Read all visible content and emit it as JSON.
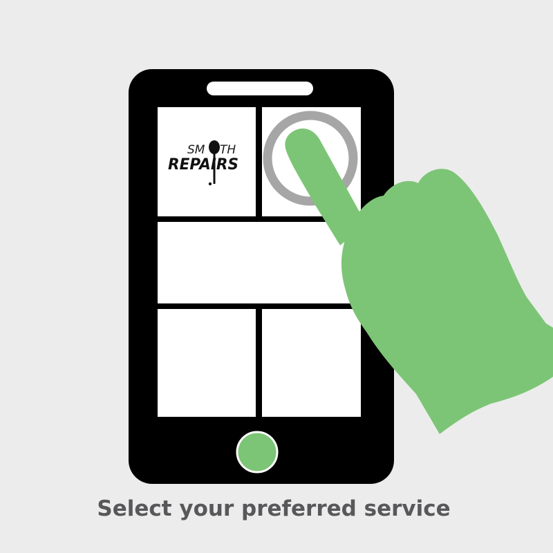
{
  "colors": {
    "background": "#ececec",
    "phone_body": "#000000",
    "screen_tile": "#ffffff",
    "accent_green": "#7dc576",
    "ring_gray": "#a6a6a6",
    "caption_text": "#58585a"
  },
  "logo": {
    "line1_left": "SM",
    "line1_right": "TH",
    "line2": "REPAIRS"
  },
  "caption": {
    "text": "Select your preferred service"
  },
  "tiles": [
    {
      "id": "logo-tile",
      "content": "logo"
    },
    {
      "id": "service-tile-top-right",
      "content": "tap-target"
    },
    {
      "id": "service-tile-wide",
      "content": "empty"
    },
    {
      "id": "service-tile-bottom-left",
      "content": "empty"
    },
    {
      "id": "service-tile-bottom-right",
      "content": "empty"
    }
  ],
  "icons": {
    "tap_ring": "touch-ring-icon",
    "hand": "pointing-hand-icon",
    "home_button": "home-button-icon",
    "speaker": "speaker-slot-icon",
    "logo_mark": "tennis-racket-icon"
  }
}
